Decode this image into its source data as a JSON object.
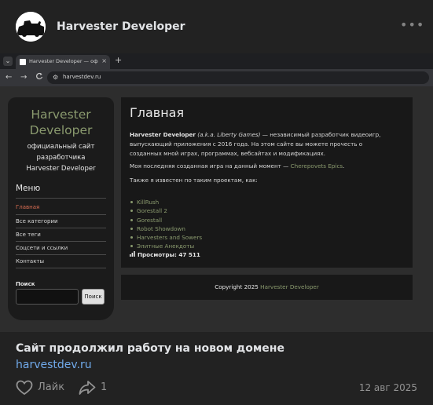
{
  "post": {
    "author": "Harvester Developer",
    "more_label": "•••",
    "text": "Сайт продолжил работу на новом домене",
    "link": "harvestdev.ru",
    "like_label": "Лайк",
    "share_count": "1",
    "date": "12 авг 2025"
  },
  "browser": {
    "tab_title": "Harvester Developer — официальный",
    "tab_close": "×",
    "new_tab": "+",
    "back": "←",
    "forward": "→",
    "reload": "C",
    "url": "harvestdev.ru"
  },
  "site": {
    "title_line1": "Harvester",
    "title_line2": "Developer",
    "subtitle_line1": "официальный сайт",
    "subtitle_line2": "разработчика",
    "subtitle_line3": "Harvester Developer",
    "menu_heading": "Меню",
    "menu": [
      {
        "label": "Главная",
        "active": true
      },
      {
        "label": "Все категории"
      },
      {
        "label": "Все теги"
      },
      {
        "label": "Соцсети и ссылки"
      },
      {
        "label": "Контакты"
      }
    ],
    "search_heading": "Поиск",
    "search_button": "Поиск",
    "main_heading": "Главная",
    "intro_bold": "Harvester Developer",
    "intro_aka": "(a.k.a. Liberty Games)",
    "intro_rest_line1": " — независимый разработчик видеоигр,",
    "intro_line2": "выпускающий приложения с 2016 года. На этом сайте вы можете прочесть о",
    "intro_line3": "созданных мной играх, программах, вебсайтах и модификациях.",
    "latest_text": "Моя последняя созданная игра на данный момент — ",
    "latest_link": "Cherepovets Epics",
    "latest_end": ".",
    "known_text": "Также я известен по таким проектам, как:",
    "projects": [
      "KillRush",
      "Gorestall 2",
      "Gorestall",
      "Robot Showdown",
      "Harvesters and Sowers",
      "Элитные Анекдоты"
    ],
    "views_label": "Просмотры: 47 511",
    "footer_text": "Copyright 2025 ",
    "footer_link": "Harvester Developer"
  },
  "colors": {
    "accent_green": "#8a9a6e",
    "active_menu": "#d96d52",
    "link_blue": "#71aaeb"
  }
}
